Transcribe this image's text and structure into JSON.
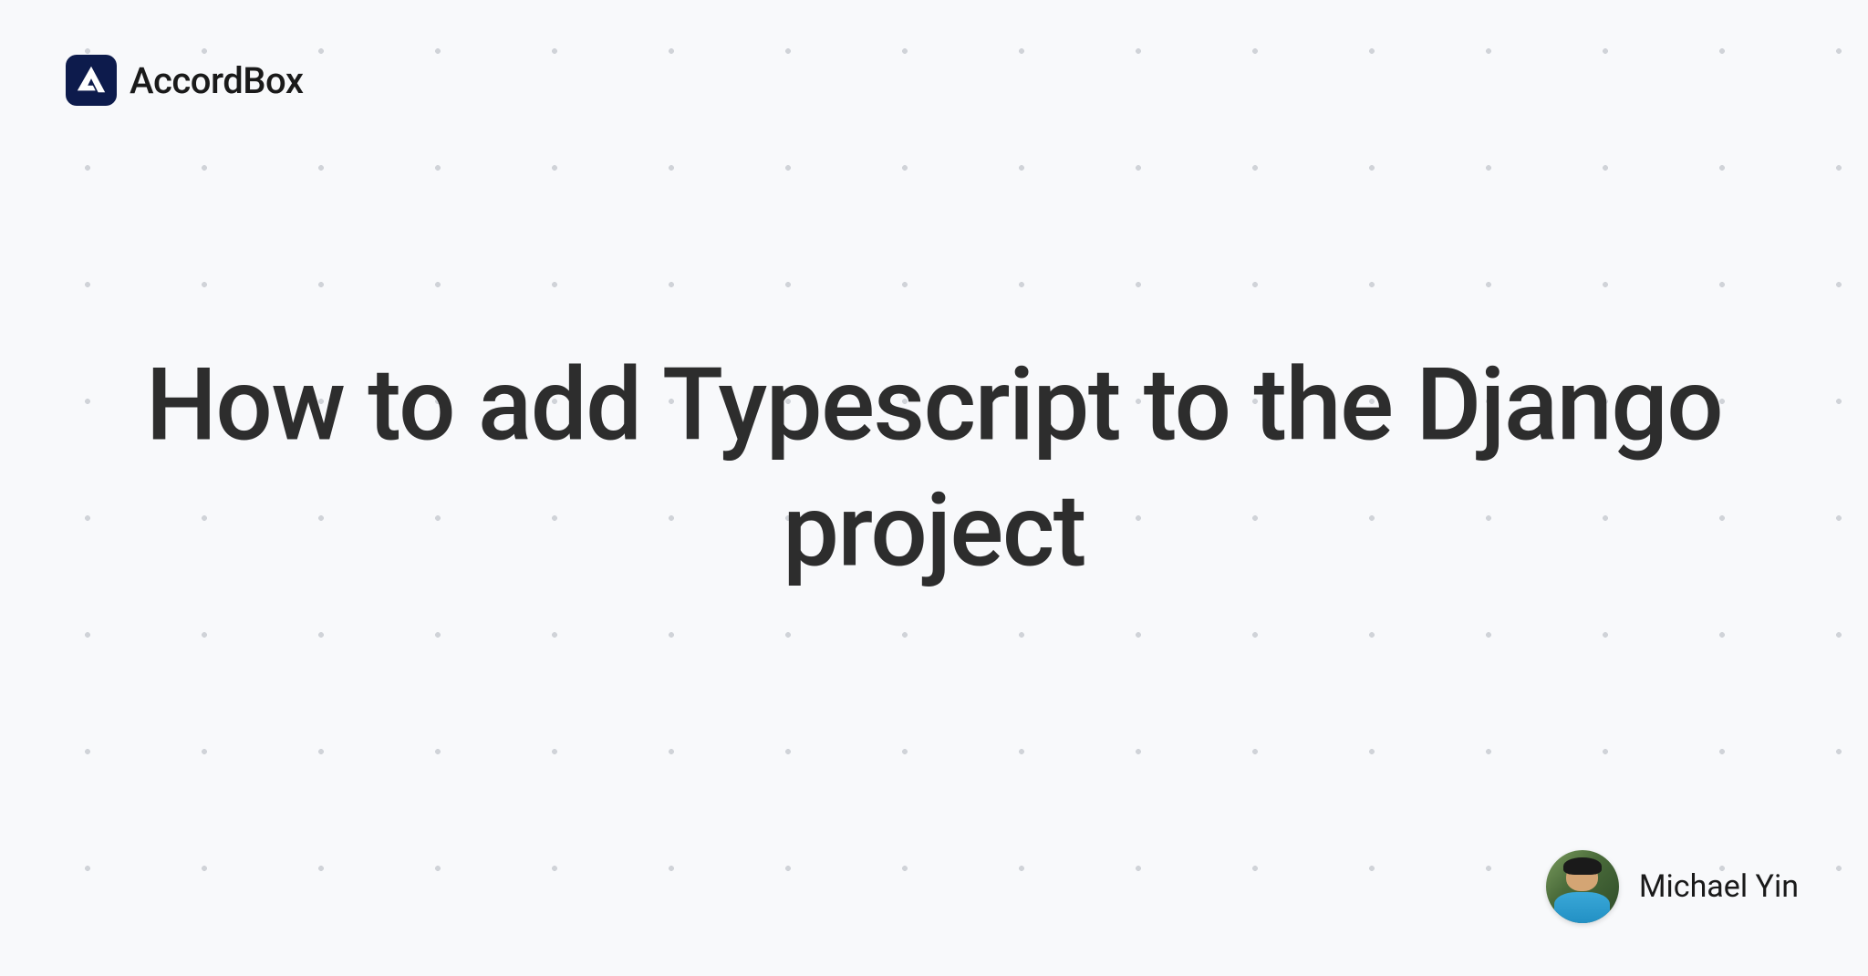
{
  "brand": {
    "name": "AccordBox"
  },
  "article": {
    "title": "How to add Typescript to the Django project"
  },
  "author": {
    "name": "Michael Yin"
  }
}
